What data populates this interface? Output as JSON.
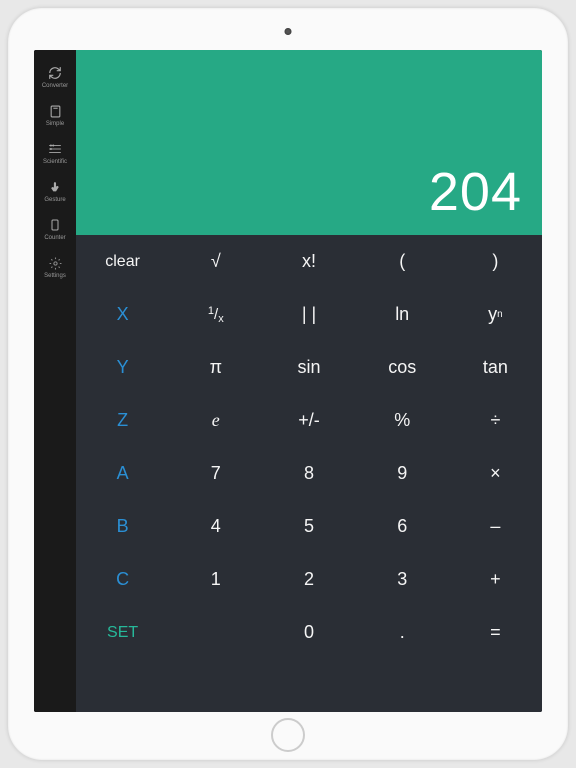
{
  "sidebar": {
    "items": [
      {
        "label": "Converter"
      },
      {
        "label": "Simple"
      },
      {
        "label": "Scientific"
      },
      {
        "label": "Gesture"
      },
      {
        "label": "Counter"
      },
      {
        "label": "Settings"
      }
    ]
  },
  "display": {
    "value": "204"
  },
  "keypad": {
    "rows": [
      [
        {
          "label": "clear",
          "type": "text"
        },
        {
          "label": "√",
          "type": "text"
        },
        {
          "label": "x!",
          "type": "text"
        },
        {
          "label": "(",
          "type": "text"
        },
        {
          "label": ")",
          "type": "text"
        }
      ],
      [
        {
          "label": "X",
          "type": "blue"
        },
        {
          "label": "1/x",
          "type": "frac"
        },
        {
          "label": "| |",
          "type": "text"
        },
        {
          "label": "ln",
          "type": "text"
        },
        {
          "label": "yⁿ",
          "type": "sup",
          "base": "y",
          "sup": "n"
        }
      ],
      [
        {
          "label": "Y",
          "type": "blue"
        },
        {
          "label": "π",
          "type": "text"
        },
        {
          "label": "sin",
          "type": "text"
        },
        {
          "label": "cos",
          "type": "text"
        },
        {
          "label": "tan",
          "type": "text"
        }
      ],
      [
        {
          "label": "Z",
          "type": "blue"
        },
        {
          "label": "e",
          "type": "italic"
        },
        {
          "label": "+/-",
          "type": "text"
        },
        {
          "label": "%",
          "type": "text"
        },
        {
          "label": "÷",
          "type": "text"
        }
      ],
      [
        {
          "label": "A",
          "type": "blue"
        },
        {
          "label": "7",
          "type": "text"
        },
        {
          "label": "8",
          "type": "text"
        },
        {
          "label": "9",
          "type": "text"
        },
        {
          "label": "×",
          "type": "text"
        }
      ],
      [
        {
          "label": "B",
          "type": "blue"
        },
        {
          "label": "4",
          "type": "text"
        },
        {
          "label": "5",
          "type": "text"
        },
        {
          "label": "6",
          "type": "text"
        },
        {
          "label": "–",
          "type": "text"
        }
      ],
      [
        {
          "label": "C",
          "type": "blue"
        },
        {
          "label": "1",
          "type": "text"
        },
        {
          "label": "2",
          "type": "text"
        },
        {
          "label": "3",
          "type": "text"
        },
        {
          "label": "+",
          "type": "text"
        }
      ],
      [
        {
          "label": "SET",
          "type": "teal"
        },
        {
          "label": "",
          "type": "text"
        },
        {
          "label": "0",
          "type": "text"
        },
        {
          "label": ".",
          "type": "text"
        },
        {
          "label": "=",
          "type": "text"
        }
      ]
    ]
  }
}
